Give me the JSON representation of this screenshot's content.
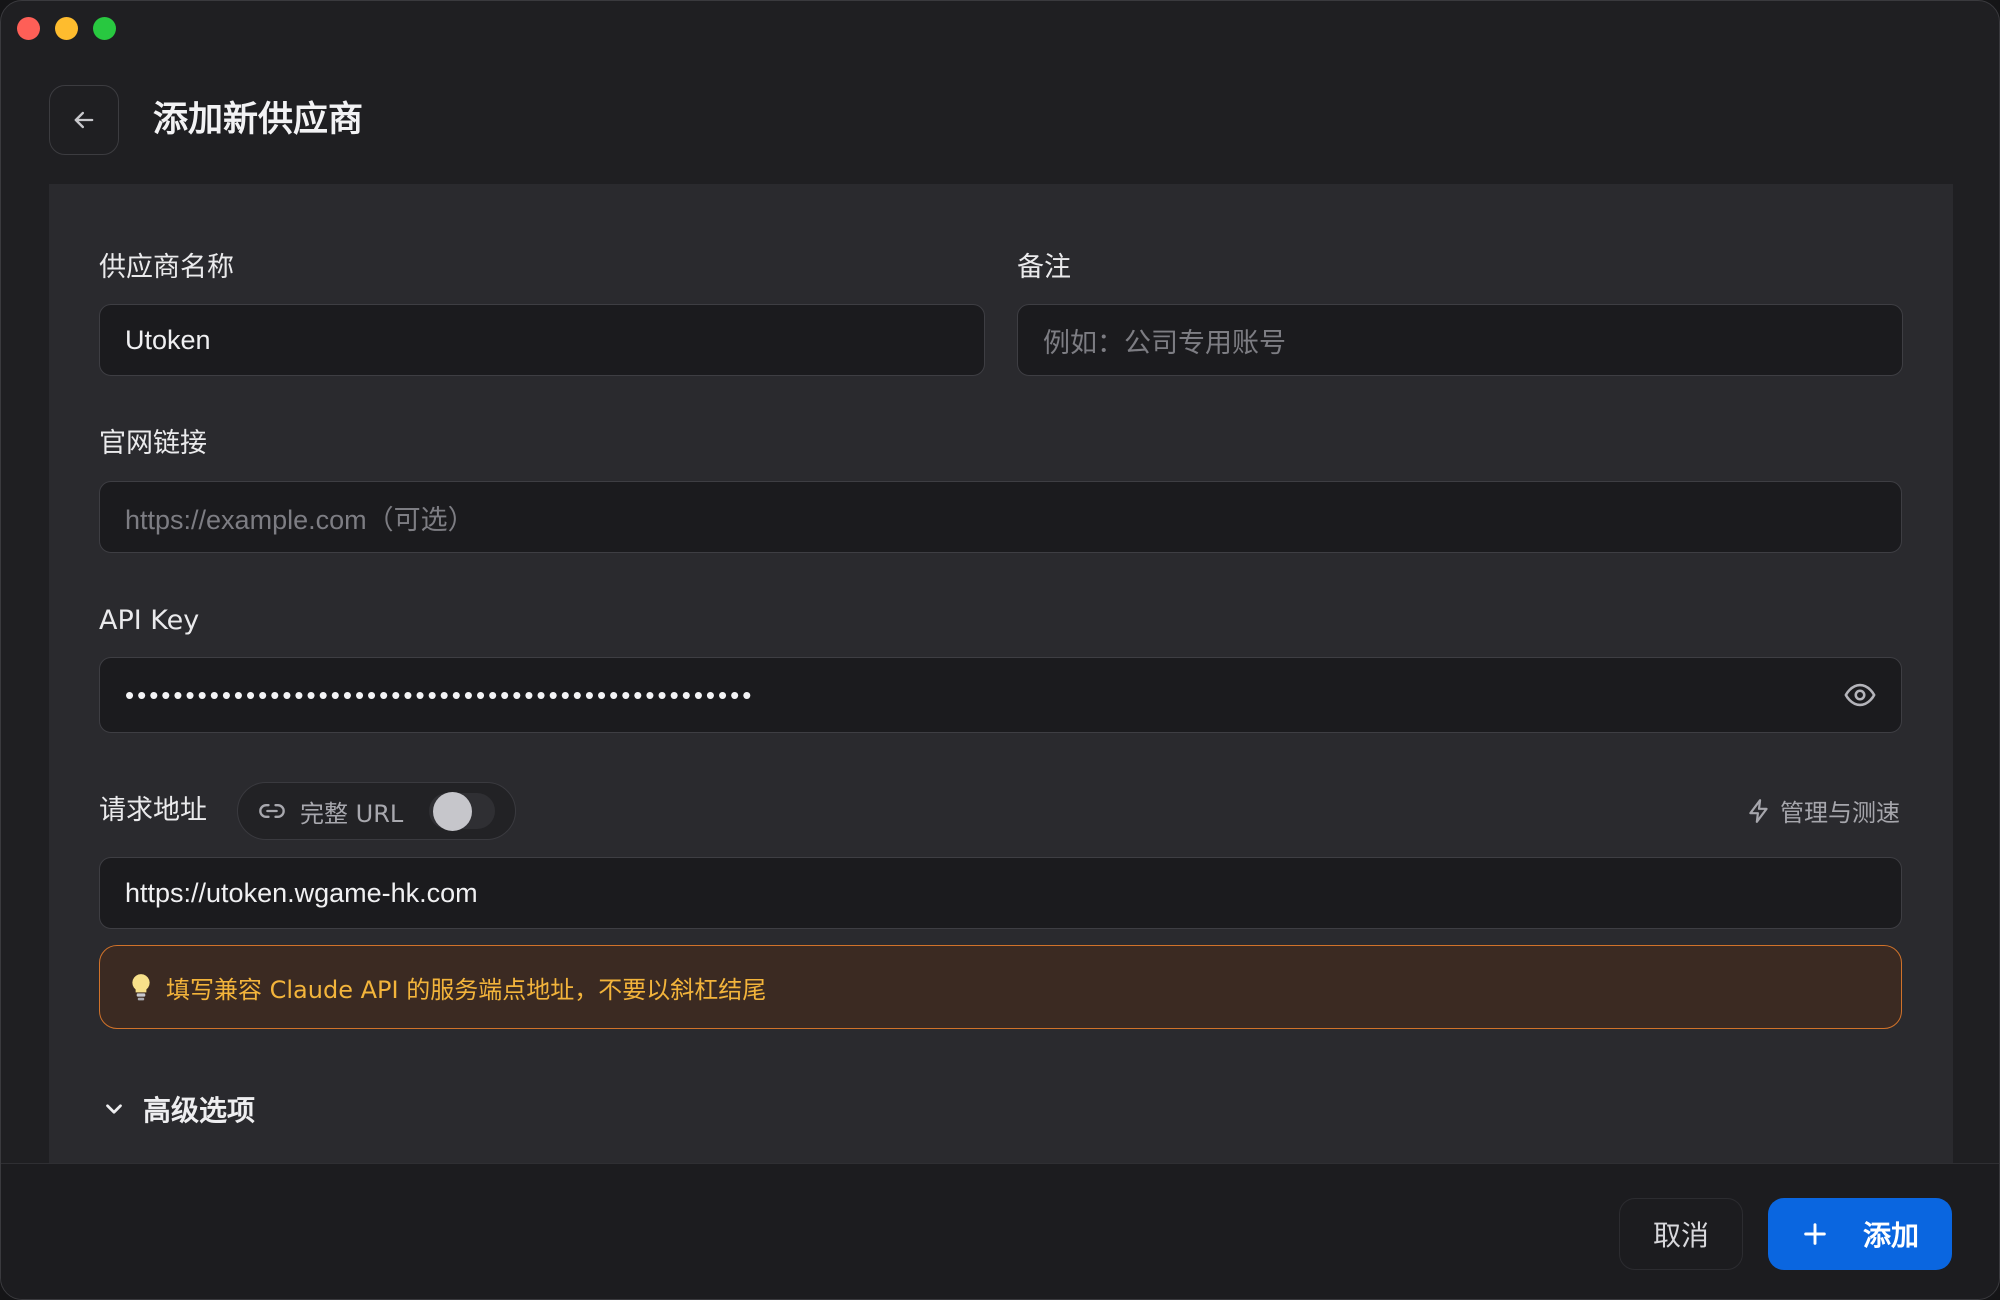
{
  "header": {
    "title": "添加新供应商"
  },
  "form": {
    "provider_name": {
      "label": "供应商名称",
      "value": "Utoken"
    },
    "notes": {
      "label": "备注",
      "placeholder": "例如：公司专用账号"
    },
    "website": {
      "label": "官网链接",
      "placeholder": "https://example.com（可选）"
    },
    "api_key": {
      "label": "API Key",
      "masked_value": "••••••••••••••••••••••••••••••••••••••••••••••••••••"
    },
    "endpoint": {
      "label": "请求地址",
      "full_url_toggle_label": "完整 URL",
      "full_url_enabled": false,
      "manage_label": "管理与测速",
      "value": "https://utoken.wgame-hk.com",
      "tip": "填写兼容 Claude API 的服务端点地址，不要以斜杠结尾"
    },
    "advanced_label": "高级选项"
  },
  "footer": {
    "cancel_label": "取消",
    "add_label": "添加"
  },
  "colors": {
    "accent": "#0a66e0",
    "warning_border": "#d0722a",
    "warning_text": "#f3b43b"
  }
}
